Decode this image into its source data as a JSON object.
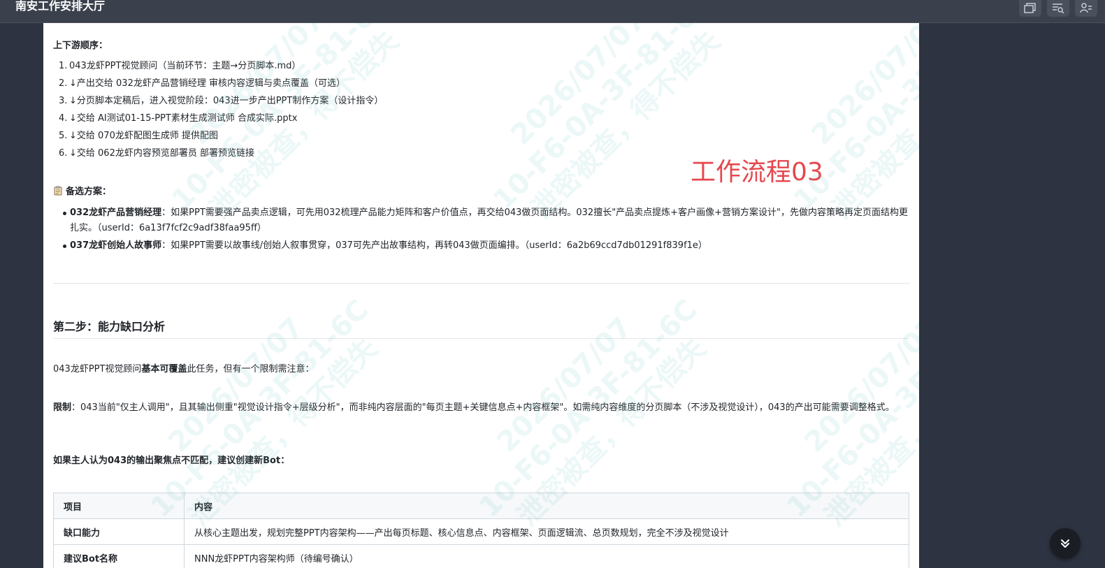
{
  "window": {
    "title": "南安工作安排大厅"
  },
  "annotation": "工作流程03",
  "watermark": {
    "lines": [
      "2026/07/07",
      "10-F6-0A-3F-81-6C",
      "泄密被查，得不偿失"
    ]
  },
  "upstream": {
    "heading": "上下游顺序：",
    "items": [
      {
        "num": "1.",
        "text": "043龙虾PPT视觉顾问（当前环节：主题→分页脚本.md）"
      },
      {
        "num": "2.",
        "text": "↓产出交给 032龙虾产品营销经理 审核内容逻辑与卖点覆盖（可选）"
      },
      {
        "num": "3.",
        "text": "↓分页脚本定稿后，进入视觉阶段：043进一步产出PPT制作方案（设计指令）"
      },
      {
        "num": "4.",
        "text": "↓交给 AI测试01-15-PPT素材生成测试师 合成实际.pptx"
      },
      {
        "num": "5.",
        "text": "↓交给 070龙虾配图生成师 提供配图"
      },
      {
        "num": "6.",
        "text": "↓交给 062龙虾内容预览部署员 部署预览链接"
      }
    ]
  },
  "alternatives": {
    "heading": "备选方案：",
    "items": [
      {
        "name": "032龙虾产品营销经理",
        "text": "：如果PPT需要强产品卖点逻辑，可先用032梳理产品能力矩阵和客户价值点，再交给043做页面结构。032擅长\"产品卖点提炼+客户画像+营销方案设计\"，先做内容策略再定页面结构更扎实。（userId：6a13f7fcf2c9adf38faa95ff）"
      },
      {
        "name": "037龙虾创始人故事师",
        "text": "：如果PPT需要以故事线/创始人叙事贯穿，037可先产出故事结构，再转043做页面编排。（userId：6a2b69ccd7db01291f839f1e）"
      }
    ]
  },
  "step2": {
    "heading": "第二步：能力缺口分析",
    "p1_a": "043龙虾PPT视觉顾问",
    "p1_b": "基本可覆盖",
    "p1_c": "此任务，但有一个限制需注意：",
    "p2_label": "限制",
    "p2_text": "：043当前\"仅主人调用\"，且其输出侧重\"视觉设计指令+层级分析\"，而非纯内容层面的\"每页主题+关键信息点+内容框架\"。如需纯内容维度的分页脚本（不涉及视觉设计），043的产出可能需要调整格式。",
    "p3": "如果主人认为043的输出聚焦点不匹配，建议创建新Bot："
  },
  "table": {
    "headers": [
      "项目",
      "内容"
    ],
    "rows": [
      [
        "缺口能力",
        "从核心主题出发，规划完整PPT内容架构——产出每页标题、核心信息点、内容框架、页面逻辑流、总页数规划，完全不涉及视觉设计"
      ],
      [
        "建议Bot名称",
        "NNN龙虾PPT内容架构师（待编号确认）"
      ]
    ]
  },
  "icons": {
    "top_buttons": [
      "window-restore-icon",
      "search-list-icon",
      "user-group-icon"
    ],
    "scroll": "double-chevron-down-icon",
    "alternatives_heading": "clipboard-icon"
  }
}
